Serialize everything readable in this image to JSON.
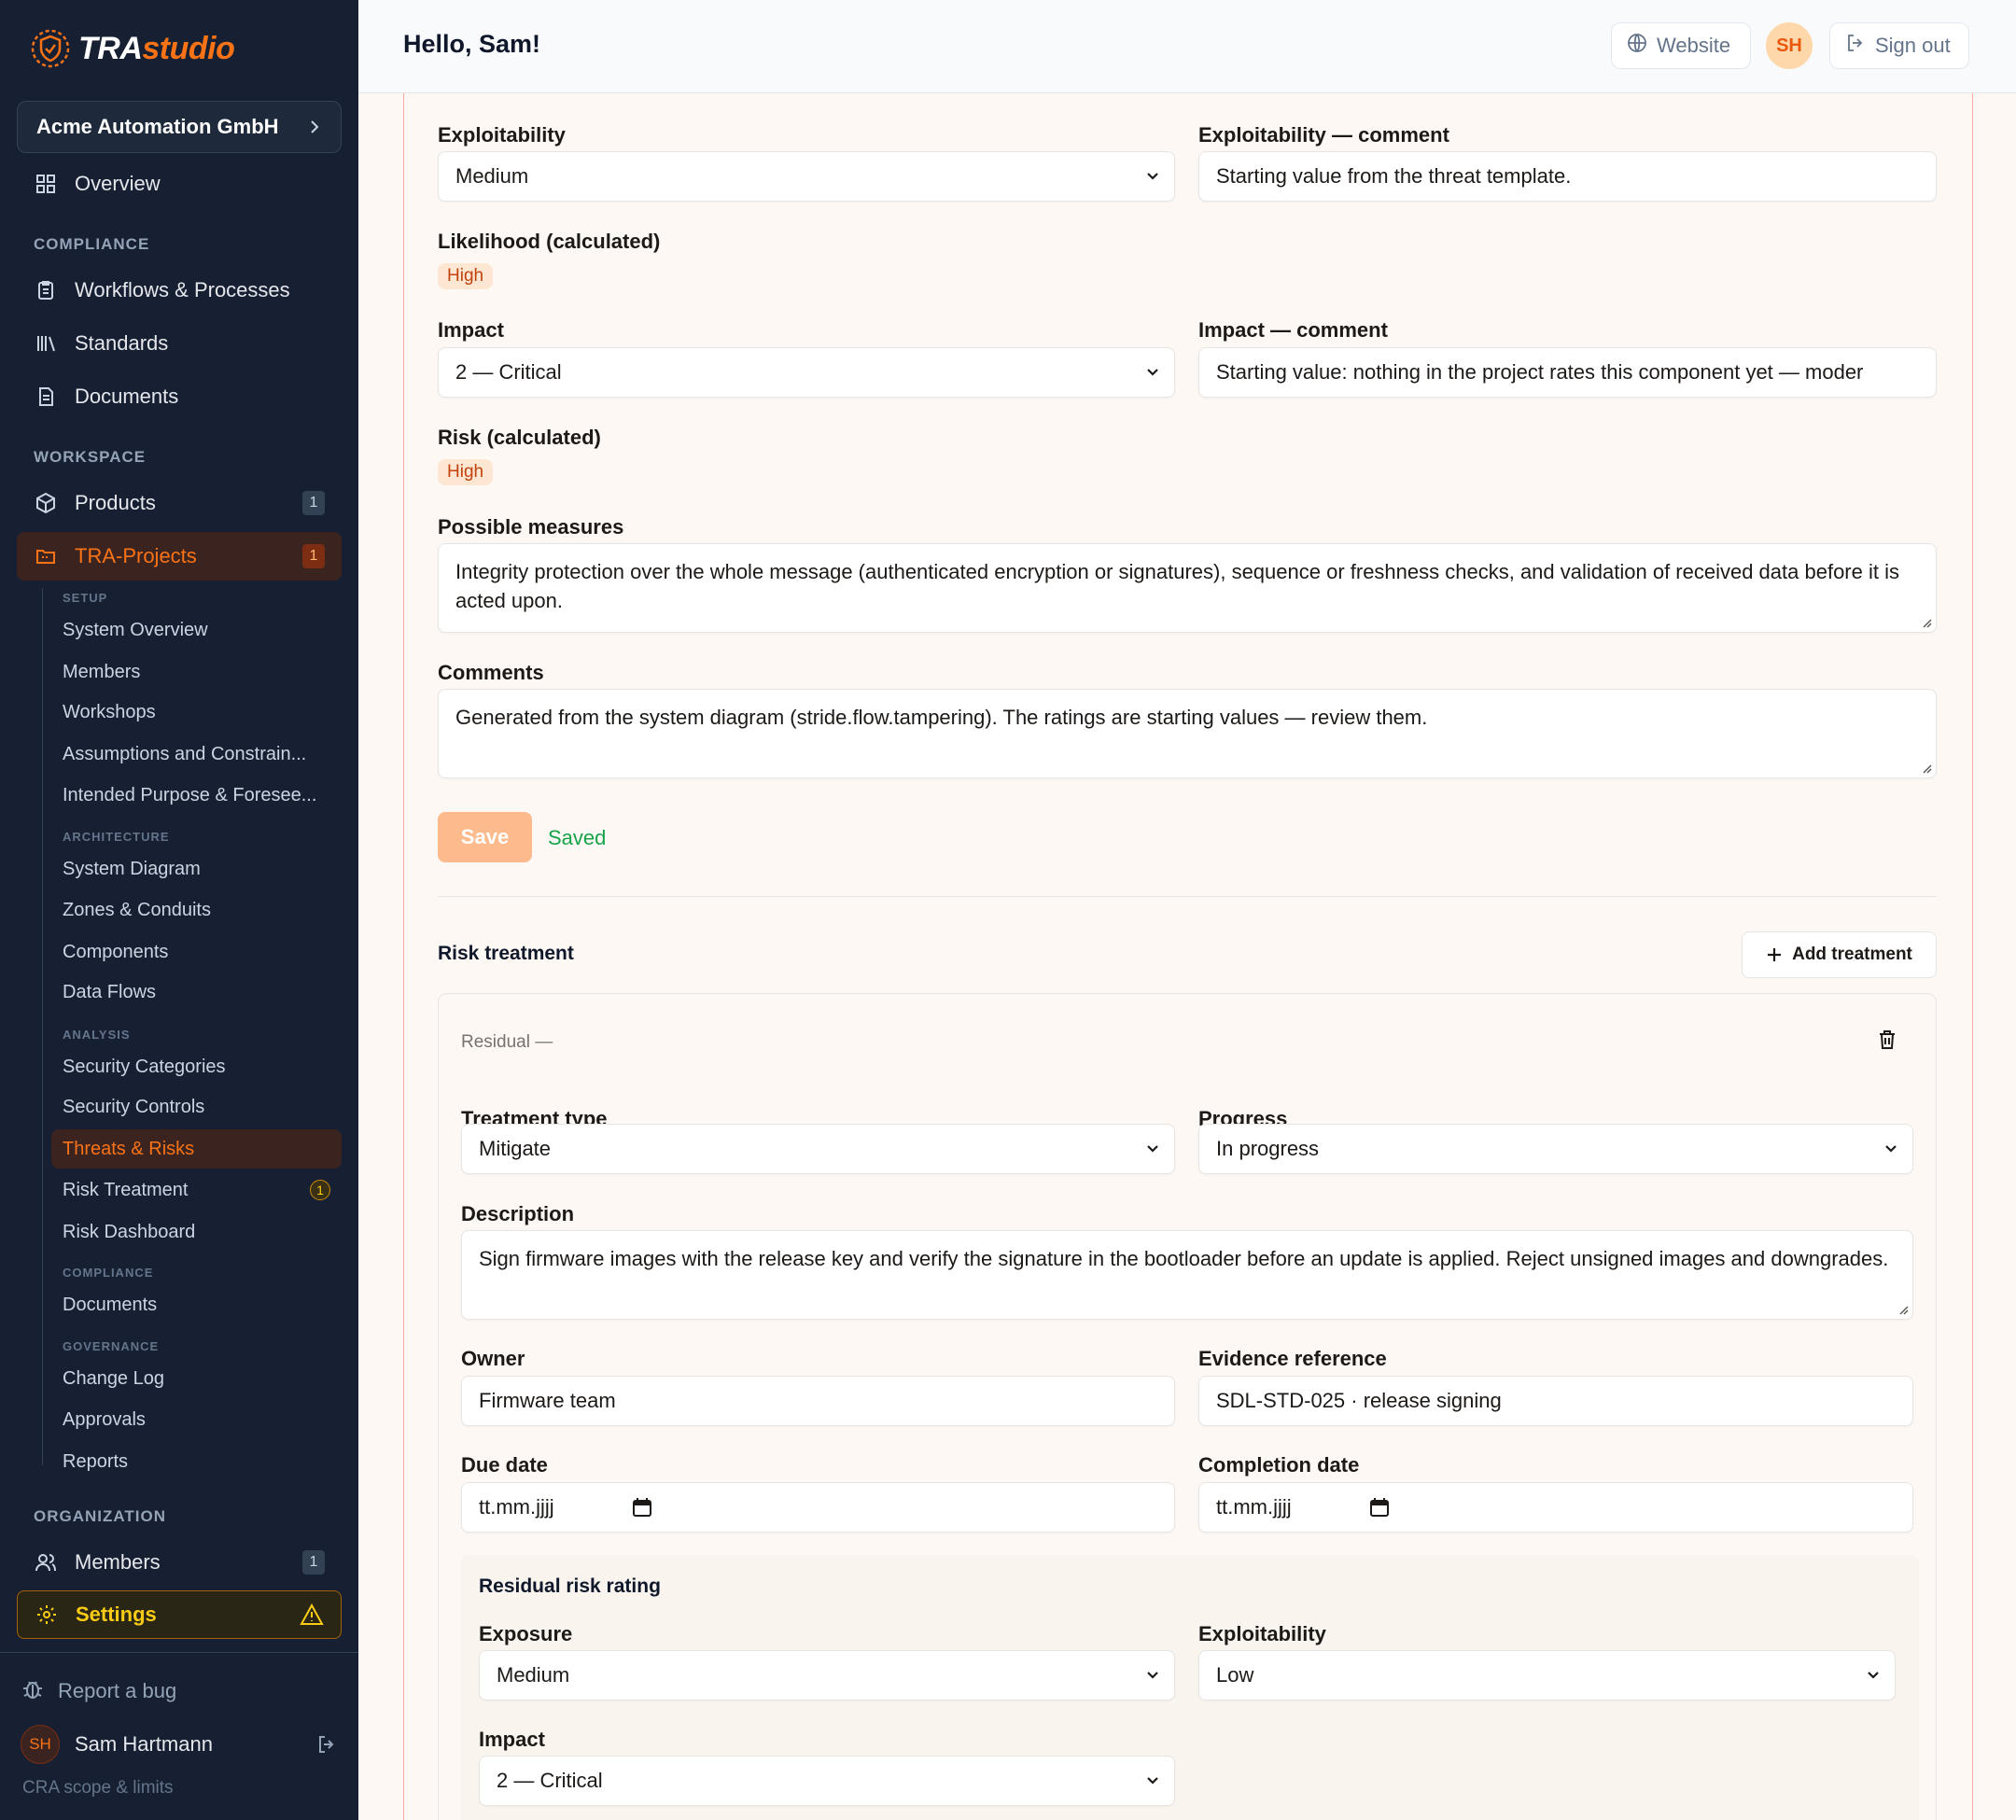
{
  "sidebar": {
    "brand": {
      "name_plain": "TRA",
      "name_accent": "studio",
      "icon": "shield-logo-icon"
    },
    "org_selector": {
      "label": "Acme Automation GmbH",
      "icon": "chevron-right-icon"
    },
    "overview": "Overview",
    "sections": {
      "compliance": "COMPLIANCE",
      "workspace": "WORKSPACE",
      "organization": "ORGANIZATION"
    },
    "compliance_items": [
      {
        "label": "Workflows & Processes",
        "icon": "clipboard-icon"
      },
      {
        "label": "Standards",
        "icon": "library-icon"
      },
      {
        "label": "Documents",
        "icon": "document-icon"
      }
    ],
    "products": {
      "label": "Products",
      "count": "1"
    },
    "tra_projects": {
      "label": "TRA-Projects",
      "count": "1"
    },
    "subsections": {
      "setup": "SETUP",
      "architecture": "ARCHITECTURE",
      "analysis": "ANALYSIS",
      "compliance": "COMPLIANCE",
      "governance": "GOVERNANCE"
    },
    "setup_links": [
      "System Overview",
      "Members",
      "Workshops",
      "Assumptions and Constrain...",
      "Intended Purpose & Foresee..."
    ],
    "architecture_links": [
      "System Diagram",
      "Zones & Conduits",
      "Components",
      "Data Flows"
    ],
    "analysis_links": [
      "Security Categories",
      "Security Controls",
      "Threats & Risks",
      "Risk Treatment",
      "Risk Dashboard"
    ],
    "risk_treatment_count": "1",
    "compliance_links": [
      "Documents"
    ],
    "governance_links": [
      "Change Log",
      "Approvals",
      "Reports"
    ],
    "members": {
      "label": "Members",
      "count": "1"
    },
    "settings": {
      "label": "Settings",
      "warning_icon": "warning-icon"
    },
    "report_bug": "Report a bug",
    "user": {
      "initials": "SH",
      "name": "Sam Hartmann"
    },
    "cra_link": "CRA scope & limits"
  },
  "header": {
    "greeting": "Hello, Sam!",
    "website_label": "Website",
    "avatar_initials": "SH",
    "sign_out_label": "Sign out"
  },
  "form": {
    "exploitability": {
      "label": "Exploitability",
      "value": "Medium"
    },
    "exploitability_comment": {
      "label": "Exploitability — comment",
      "value": "Starting value from the threat template."
    },
    "likelihood": {
      "label": "Likelihood (calculated)",
      "value": "High"
    },
    "impact": {
      "label": "Impact",
      "value": "2 — Critical"
    },
    "impact_comment": {
      "label": "Impact — comment",
      "value": "Starting value: nothing in the project rates this component yet — moder"
    },
    "risk": {
      "label": "Risk (calculated)",
      "value": "High"
    },
    "possible_measures": {
      "label": "Possible measures",
      "value": "Integrity protection over the whole message (authenticated encryption or signatures), sequence or freshness checks, and validation of received data before it is acted upon."
    },
    "comments": {
      "label": "Comments",
      "value": "Generated from the system diagram (stride.flow.tampering). The ratings are starting values — review them."
    },
    "save_label": "Save",
    "saved_label": "Saved"
  },
  "risk_treatment": {
    "title": "Risk treatment",
    "add_label": "Add treatment",
    "residual_label": "Residual —",
    "treatment_type": {
      "label": "Treatment type",
      "value": "Mitigate"
    },
    "progress": {
      "label": "Progress",
      "value": "In progress"
    },
    "description": {
      "label": "Description",
      "value": "Sign firmware images with the release key and verify the signature in the bootloader before an update is applied. Reject unsigned images and downgrades."
    },
    "owner": {
      "label": "Owner",
      "value": "Firmware team"
    },
    "evidence": {
      "label": "Evidence reference",
      "value": "SDL-STD-025 · release signing"
    },
    "due_date": {
      "label": "Due date",
      "placeholder": "tt.mm.jjjj"
    },
    "completion_date": {
      "label": "Completion date",
      "placeholder": "tt.mm.jjjj"
    },
    "residual_rating": {
      "title": "Residual risk rating",
      "exposure": {
        "label": "Exposure",
        "value": "Medium"
      },
      "exploitability": {
        "label": "Exploitability",
        "value": "Low"
      },
      "impact": {
        "label": "Impact",
        "value": "2 — Critical"
      }
    }
  },
  "colors": {
    "accent": "#f97316",
    "sidebar_bg": "#172033",
    "saved_green": "#16a34a",
    "warning": "#facc15"
  }
}
